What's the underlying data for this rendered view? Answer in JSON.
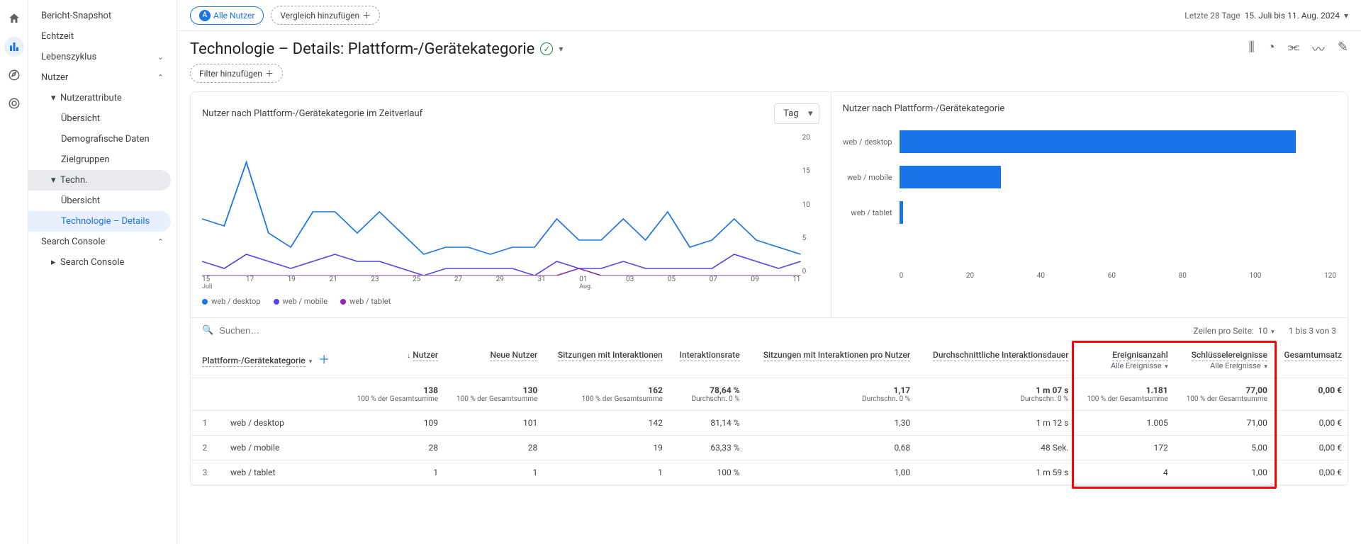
{
  "rail": {
    "home": "home",
    "reports": "reports",
    "explore": "explore",
    "ads": "ads"
  },
  "sidebar": {
    "snapshot": "Bericht-Snapshot",
    "realtime": "Echtzeit",
    "lifecycle": "Lebenszyklus",
    "user": "Nutzer",
    "user_attr": "Nutzerattribute",
    "overview1": "Übersicht",
    "demo": "Demografische Daten",
    "audiences": "Zielgruppen",
    "tech": "Techn.",
    "overview2": "Übersicht",
    "tech_details": "Technologie – Details",
    "search_console": "Search Console",
    "search_console_item": "Search Console"
  },
  "topbar": {
    "badge": "A",
    "all_users": "Alle Nutzer",
    "add_compare": "Vergleich hinzufügen",
    "date_range_label": "Letzte 28 Tage",
    "date_range": "15. Juli bis 11. Aug. 2024"
  },
  "header": {
    "title": "Technologie – Details: Plattform-/Gerätekategorie",
    "add_filter": "Filter hinzufügen"
  },
  "chart_line": {
    "title": "Nutzer nach Plattform-/Gerätekategorie im Zeitverlauf",
    "granularity": "Tag",
    "legend": [
      "web / desktop",
      "web / mobile",
      "web / tablet"
    ]
  },
  "chart_bar": {
    "title": "Nutzer nach Plattform-/Gerätekategorie"
  },
  "chart_data": [
    {
      "type": "line",
      "title": "Nutzer nach Plattform-/Gerätekategorie im Zeitverlauf",
      "x_ticks": [
        "15",
        "17",
        "19",
        "21",
        "23",
        "25",
        "27",
        "29",
        "31",
        "01",
        "03",
        "05",
        "07",
        "09",
        "11"
      ],
      "x_month_labels": {
        "15": "Juli",
        "01": "Aug."
      },
      "y_ticks": [
        0,
        5,
        10,
        15,
        20
      ],
      "ylim": [
        0,
        20
      ],
      "series": [
        {
          "name": "web / desktop",
          "color": "#1a73e8",
          "values": [
            8,
            7,
            16,
            6,
            4,
            9,
            9,
            6,
            9,
            6,
            3,
            4,
            4,
            3,
            4,
            4,
            8,
            5,
            5,
            8,
            5,
            9,
            4,
            5,
            8,
            5,
            4,
            3
          ]
        },
        {
          "name": "web / mobile",
          "color": "#4f46e5",
          "values": [
            2,
            1,
            3,
            2,
            1,
            2,
            3,
            2,
            2,
            1,
            0,
            1,
            1,
            1,
            1,
            0,
            2,
            1,
            1,
            2,
            1,
            1,
            1,
            1,
            3,
            2,
            1,
            2
          ]
        },
        {
          "name": "web / tablet",
          "color": "#8e24aa",
          "values": [
            0,
            0,
            0,
            0,
            0,
            0,
            0,
            0,
            0,
            0,
            0,
            0,
            0,
            0,
            0,
            0,
            0,
            1,
            0,
            0,
            0,
            0,
            0,
            0,
            0,
            0,
            0,
            0
          ]
        }
      ]
    },
    {
      "type": "bar",
      "title": "Nutzer nach Plattform-/Gerätekategorie",
      "orientation": "horizontal",
      "x_ticks": [
        0,
        20,
        40,
        60,
        80,
        100,
        120
      ],
      "categories": [
        "web / desktop",
        "web / mobile",
        "web / tablet"
      ],
      "values": [
        109,
        28,
        1
      ],
      "color": "#1a73e8"
    }
  ],
  "table": {
    "search_ph": "Suchen…",
    "rows_per_page_label": "Zeilen pro Seite:",
    "rows_per_page": "10",
    "range": "1 bis 3 von 3",
    "dim_header": "Plattform-/Gerätekategorie",
    "cols": {
      "users": "Nutzer",
      "new_users": "Neue Nutzer",
      "eng_sessions": "Sitzungen mit Interaktionen",
      "eng_rate": "Interaktionsrate",
      "sess_per_user": "Sitzungen mit Interaktionen pro Nutzer",
      "avg_dur": "Durchschnittliche Interaktionsdauer",
      "events": "Ereignisanzahl",
      "key_events": "Schlüsselereignisse",
      "revenue": "Gesamtumsatz",
      "all_events": "Alle Ereignisse"
    },
    "summary": {
      "users": "138",
      "new_users": "130",
      "eng_sessions": "162",
      "eng_rate": "78,64 %",
      "sess_per_user": "1,17",
      "avg_dur": "1 m 07 s",
      "events": "1.181",
      "key_events": "77,00",
      "revenue": "0,00 €",
      "pct": "100 % der Gesamtsumme",
      "avg": "Durchschn. 0 %"
    },
    "rows": [
      {
        "idx": "1",
        "dim": "web / desktop",
        "users": "109",
        "new_users": "101",
        "eng_sessions": "142",
        "eng_rate": "81,14 %",
        "sess_per_user": "1,30",
        "avg_dur": "1 m 12 s",
        "events": "1.005",
        "key_events": "71,00",
        "revenue": "0,00 €"
      },
      {
        "idx": "2",
        "dim": "web / mobile",
        "users": "28",
        "new_users": "28",
        "eng_sessions": "19",
        "eng_rate": "63,33 %",
        "sess_per_user": "0,68",
        "avg_dur": "48 Sek.",
        "events": "172",
        "key_events": "5,00",
        "revenue": "0,00 €"
      },
      {
        "idx": "3",
        "dim": "web / tablet",
        "users": "1",
        "new_users": "1",
        "eng_sessions": "1",
        "eng_rate": "100 %",
        "sess_per_user": "1,00",
        "avg_dur": "1 m 59 s",
        "events": "4",
        "key_events": "1,00",
        "revenue": "0,00 €"
      }
    ]
  }
}
